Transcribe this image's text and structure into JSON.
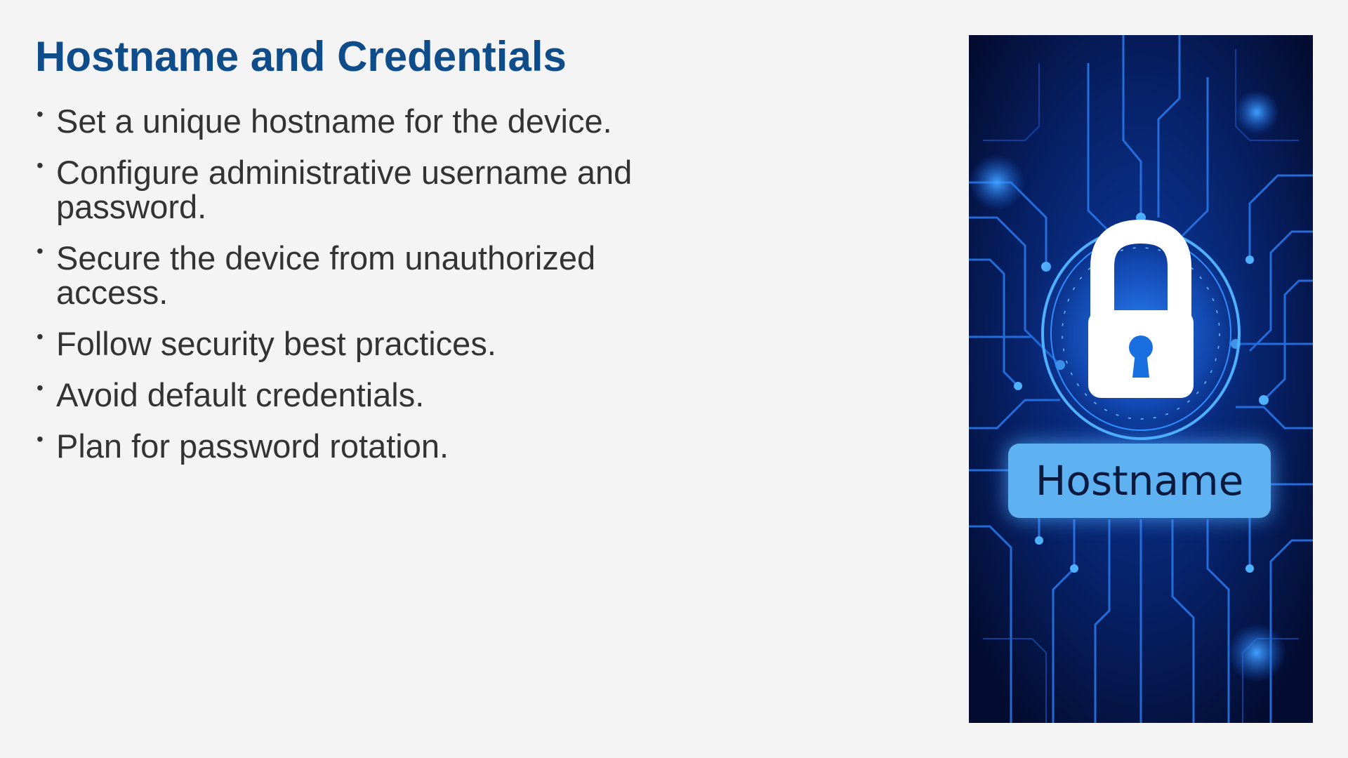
{
  "slide": {
    "title": "Hostname and Credentials",
    "bullets": [
      "Set a unique hostname for the device.",
      "Configure administrative username and password.",
      "Secure the device from unauthorized access.",
      "Follow security best practices.",
      "Avoid default credentials.",
      "Plan for password rotation."
    ]
  },
  "image": {
    "icon": "padlock-icon",
    "badge_label": "Hostname"
  },
  "colors": {
    "title": "#0f4c8a",
    "body_text": "#333333",
    "background": "#f4f4f4",
    "image_background": "#04103a",
    "circuit_accent": "#2f8cff",
    "badge": "#5fb2f2"
  }
}
